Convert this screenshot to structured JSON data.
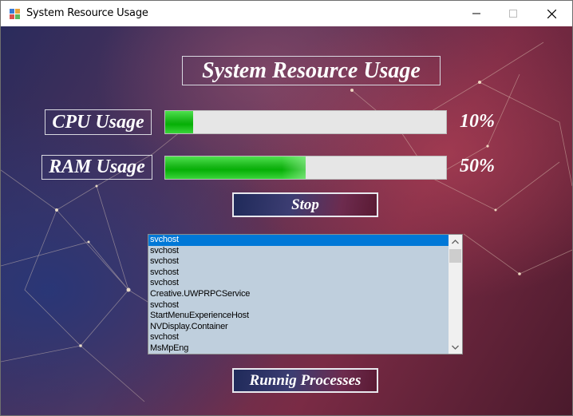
{
  "window": {
    "title": "System Resource Usage"
  },
  "heading": "System Resource Usage",
  "cpu": {
    "label": "CPU Usage",
    "value_text": "10%",
    "percent": 10
  },
  "ram": {
    "label": "RAM Usage",
    "value_text": "50%",
    "percent": 50
  },
  "stop_button": {
    "label": "Stop"
  },
  "processes": {
    "items": [
      "svchost",
      "svchost",
      "svchost",
      "svchost",
      "svchost",
      "Creative.UWPRPCService",
      "svchost",
      "StartMenuExperienceHost",
      "NVDisplay.Container",
      "svchost",
      "MsMpEng"
    ],
    "selected_index": 0
  },
  "running_button": {
    "label": "Runnig Processes"
  },
  "colors": {
    "progress_fill": "#06b006",
    "selection": "#0078d7",
    "listbox_bg": "#bfcfdd"
  },
  "icons": [
    "app-icon",
    "minimize-icon",
    "maximize-icon",
    "close-icon",
    "scroll-up-icon",
    "scroll-down-icon"
  ]
}
